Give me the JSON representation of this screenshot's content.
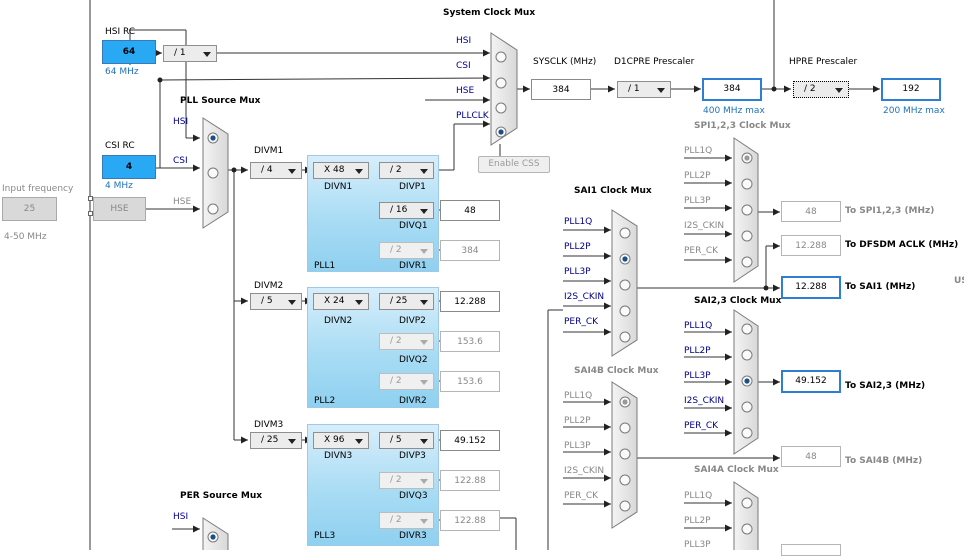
{
  "inputs": {
    "hsi_label": "HSI RC",
    "hsi_value": "64",
    "hsi_freq": "64 MHz",
    "csi_label": "CSI RC",
    "csi_value": "4",
    "csi_freq": "4 MHz",
    "input_frequency_label": "Input frequency",
    "input_frequency_value": "25",
    "input_frequency_range": "4-50 MHz",
    "hse_label": "HSE",
    "hsi_div": "/ 1"
  },
  "pll_source_mux": {
    "title": "PLL Source Mux",
    "inputs": [
      "HSI",
      "CSI",
      "HSE"
    ],
    "selected": 0
  },
  "plls": [
    {
      "divm_label": "DIVM1",
      "divm": "/ 4",
      "divn": "X 48",
      "divn_label": "DIVN1",
      "divp": "/ 2",
      "divp_label": "DIVP1",
      "divq": "/ 16",
      "divq_label": "DIVQ1",
      "divr": "/ 2",
      "divr_label": "DIVR1",
      "out_q": "48",
      "out_r": "384",
      "name": "PLL1"
    },
    {
      "divm_label": "DIVM2",
      "divm": "/ 5",
      "divn": "X 24",
      "divn_label": "DIVN2",
      "divp": "/ 25",
      "divp_label": "DIVP2",
      "divq": "/ 2",
      "divq_label": "DIVQ2",
      "divr": "/ 2",
      "divr_label": "DIVR2",
      "out_p": "12.288",
      "out_q": "153.6",
      "out_r": "153.6",
      "name": "PLL2"
    },
    {
      "divm_label": "DIVM3",
      "divm": "/ 25",
      "divn": "X 96",
      "divn_label": "DIVN3",
      "divp": "/ 5",
      "divp_label": "DIVP3",
      "divq": "/ 2",
      "divq_label": "DIVQ3",
      "divr": "/ 2",
      "divr_label": "DIVR3",
      "out_p": "49.152",
      "out_q": "122.88",
      "out_r": "122.88",
      "name": "PLL3"
    }
  ],
  "system_clock_mux": {
    "title": "System Clock Mux",
    "inputs": [
      "HSI",
      "CSI",
      "HSE",
      "PLLCLK"
    ],
    "selected": 3,
    "enable_css_label": "Enable CSS"
  },
  "sysclk": {
    "label": "SYSCLK (MHz)",
    "value": "384"
  },
  "d1cpre": {
    "label": "D1CPRE Prescaler",
    "value": "/ 1",
    "out": "384",
    "max": "400 MHz max"
  },
  "hpre": {
    "label": "HPRE Prescaler",
    "value": "/ 2",
    "out": "192",
    "max": "200 MHz max"
  },
  "spi123_mux": {
    "title": "SPI1,2,3 Clock Mux",
    "inputs": [
      "PLL1Q",
      "PLL2P",
      "PLL3P",
      "I2S_CKIN",
      "PER_CK"
    ],
    "selected": 0,
    "out": "48",
    "out_label": "To SPI1,2,3 (MHz)"
  },
  "dfsdm": {
    "out": "12.288",
    "out_label": "To DFSDM ACLK (MHz)"
  },
  "sai1_mux": {
    "title": "SAI1 Clock Mux",
    "inputs": [
      "PLL1Q",
      "PLL2P",
      "PLL3P",
      "I2S_CKIN",
      "PER_CK"
    ],
    "selected": 1,
    "out": "12.288",
    "out_label": "To SAI1 (MHz)"
  },
  "sai23_mux": {
    "title": "SAI2,3 Clock Mux",
    "inputs": [
      "PLL1Q",
      "PLL2P",
      "PLL3P",
      "I2S_CKIN",
      "PER_CK"
    ],
    "selected": 2,
    "out": "49.152",
    "out_label": "To SAI2,3 (MHz)"
  },
  "sai4b_mux": {
    "title": "SAI4B Clock Mux",
    "inputs": [
      "PLL1Q",
      "PLL2P",
      "PLL3P",
      "I2S_CKIN",
      "PER_CK"
    ],
    "selected": 0,
    "out": "48",
    "out_label": "To SAI4B (MHz)"
  },
  "sai4a_mux": {
    "title": "SAI4A Clock Mux",
    "inputs": [
      "PLL1Q",
      "PLL2P",
      "PLL3P"
    ]
  },
  "per_source_mux": {
    "title": "PER Source Mux",
    "inputs": [
      "HSI"
    ]
  },
  "edge_text": "US",
  "colors": {
    "accent_box": "#29a8f4",
    "highlight_border": "#2e7fd4",
    "pll_gradient": "#a9dcf4",
    "label_blue": "#00008b"
  }
}
